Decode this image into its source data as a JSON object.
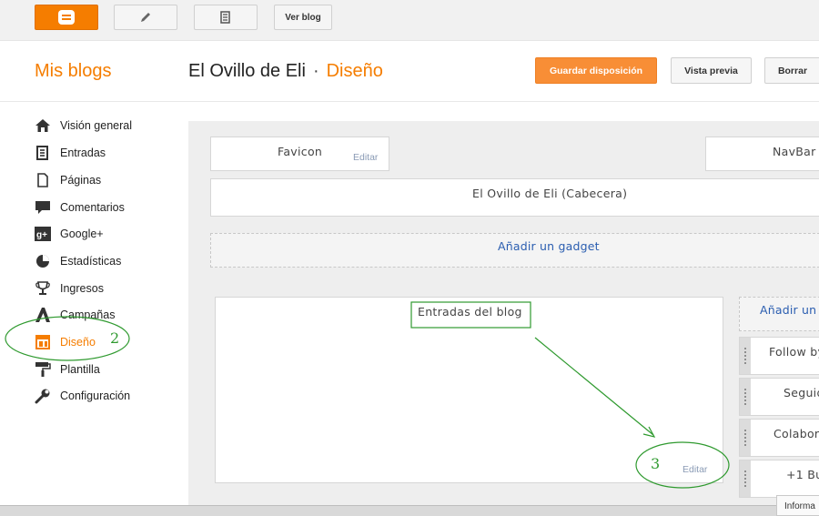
{
  "topbar": {
    "blogger_icon": "blogger-logo-icon",
    "pencil_icon": "pencil-icon",
    "posts_icon": "document-list-icon",
    "view_blog_label": "Ver blog"
  },
  "header": {
    "my_blogs": "Mis blogs",
    "blog_name": "El Ovillo de Eli",
    "separator": "·",
    "section": "Diseño",
    "save_label": "Guardar disposición",
    "preview_label": "Vista previa",
    "delete_label": "Borrar"
  },
  "sidebar": {
    "items": [
      {
        "label": "Visión general",
        "icon": "home-icon"
      },
      {
        "label": "Entradas",
        "icon": "posts-icon"
      },
      {
        "label": "Páginas",
        "icon": "pages-icon"
      },
      {
        "label": "Comentarios",
        "icon": "comments-icon"
      },
      {
        "label": "Google+",
        "icon": "google-plus-icon"
      },
      {
        "label": "Estadísticas",
        "icon": "stats-icon"
      },
      {
        "label": "Ingresos",
        "icon": "trophy-icon"
      },
      {
        "label": "Campañas",
        "icon": "adwords-icon"
      },
      {
        "label": "Diseño",
        "icon": "layout-icon",
        "active": true
      },
      {
        "label": "Plantilla",
        "icon": "paint-roller-icon"
      },
      {
        "label": "Configuración",
        "icon": "wrench-icon"
      }
    ]
  },
  "layout": {
    "favicon": {
      "title": "Favicon",
      "edit": "Editar"
    },
    "navbar": {
      "title": "NavBar"
    },
    "header": {
      "title": "El Ovillo de Eli (Cabecera)"
    },
    "add_gadget": "Añadir un gadget",
    "blog_posts": {
      "title": "Entradas del blog",
      "edit": "Editar"
    },
    "side_add": "Añadir un",
    "side_gadgets": [
      "Follow by",
      "Seguid",
      "Colabor",
      "+1 Bu"
    ]
  },
  "annotations": {
    "step_2": "2",
    "step_3": "3"
  },
  "footer": {
    "info_tab": "Informa"
  },
  "colors": {
    "brand": "#f57d00",
    "link": "#2a5db0",
    "annotation": "#2f9a2f"
  }
}
